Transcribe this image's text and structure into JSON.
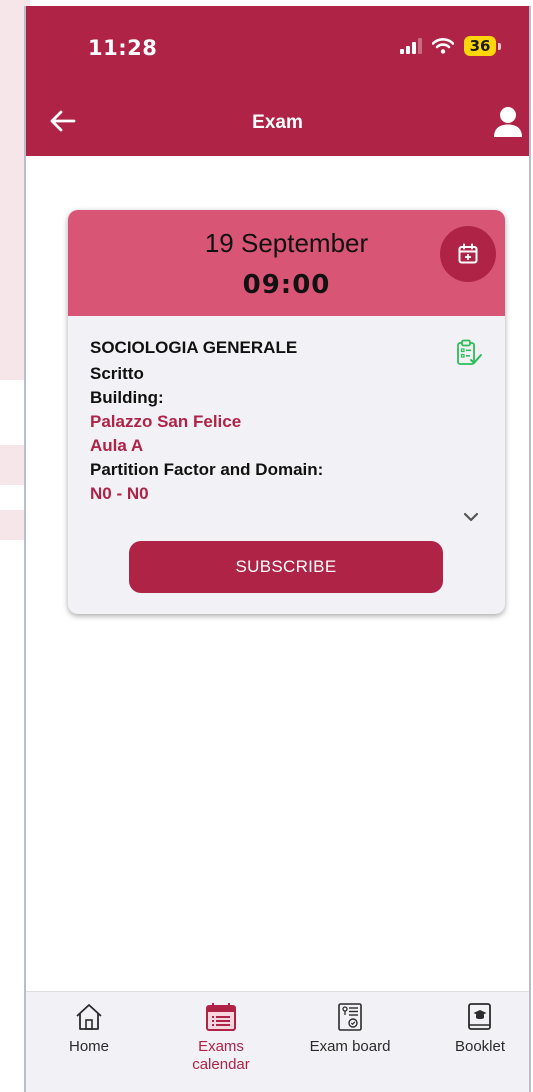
{
  "status": {
    "time": "11:28",
    "battery": "36"
  },
  "header": {
    "title": "Exam"
  },
  "exam": {
    "date": "19 September",
    "time": "09:00",
    "course": "SOCIOLOGIA GENERALE",
    "type": "Scritto",
    "building_label": "Building:",
    "building": "Palazzo San Felice",
    "room": "Aula A",
    "partition_label": "Partition Factor and Domain:",
    "partition": "N0 - N0",
    "subscribe_label": "SUBSCRIBE"
  },
  "tabs": [
    {
      "label": "Home",
      "icon": "home-icon"
    },
    {
      "label": "Exams\ncalendar",
      "icon": "calendar-list-icon"
    },
    {
      "label": "Exam board",
      "icon": "exam-board-icon"
    },
    {
      "label": "Booklet",
      "icon": "booklet-icon"
    }
  ],
  "colors": {
    "primary": "#ae2346",
    "card_header": "#d95575",
    "card_bg": "#f2f2f6",
    "clipboard_icon": "#2ebd59"
  }
}
